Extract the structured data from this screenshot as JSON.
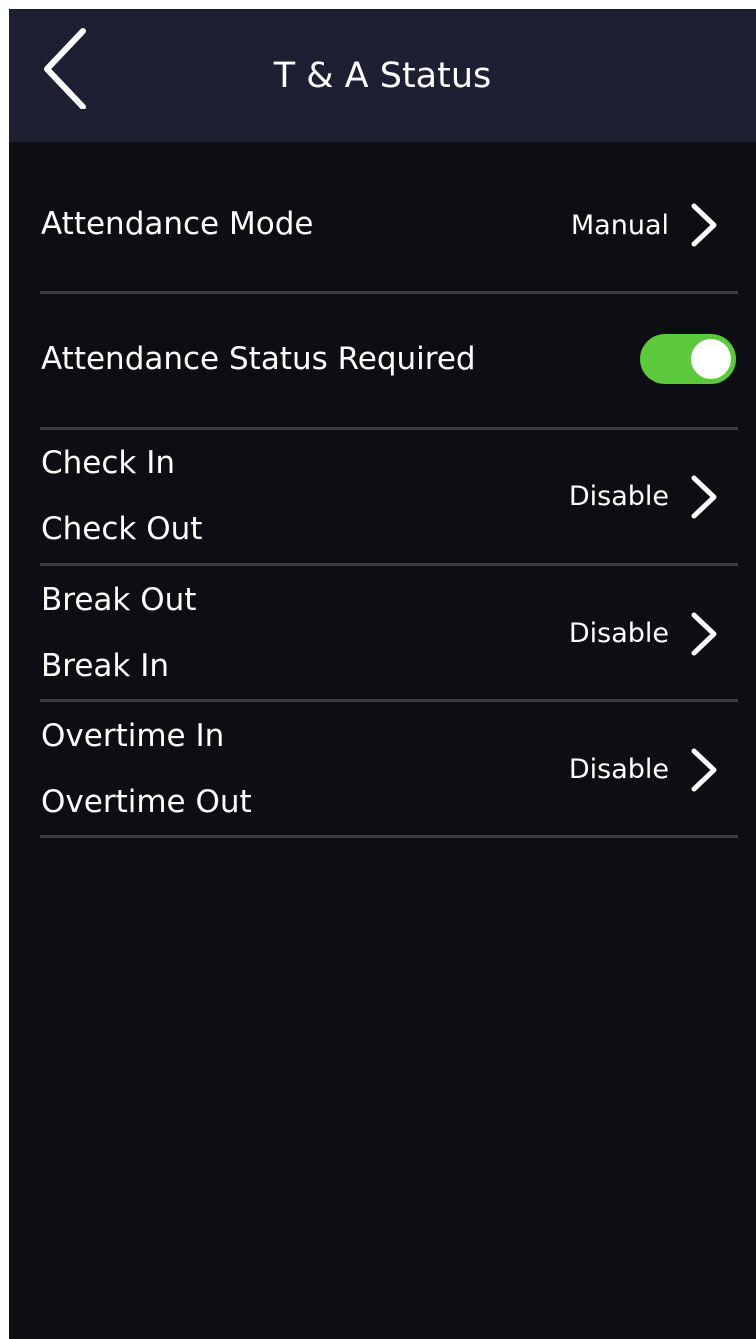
{
  "header": {
    "title": "T & A Status",
    "back_icon": "chevron-left-icon"
  },
  "settings": {
    "attendance_mode": {
      "label": "Attendance Mode",
      "value": "Manual"
    },
    "attendance_status_required": {
      "label": "Attendance Status Required",
      "enabled": true
    },
    "check": {
      "label_in": "Check In",
      "label_out": "Check Out",
      "value": "Disable"
    },
    "break": {
      "label_out": "Break Out",
      "label_in": "Break In",
      "value": "Disable"
    },
    "overtime": {
      "label_in": "Overtime In",
      "label_out": "Overtime Out",
      "value": "Disable"
    }
  },
  "colors": {
    "background": "#0d0e14",
    "header": "#1d2032",
    "toggle_on": "#5cc93c",
    "divider": "#3a3b40",
    "text": "#ffffff"
  }
}
